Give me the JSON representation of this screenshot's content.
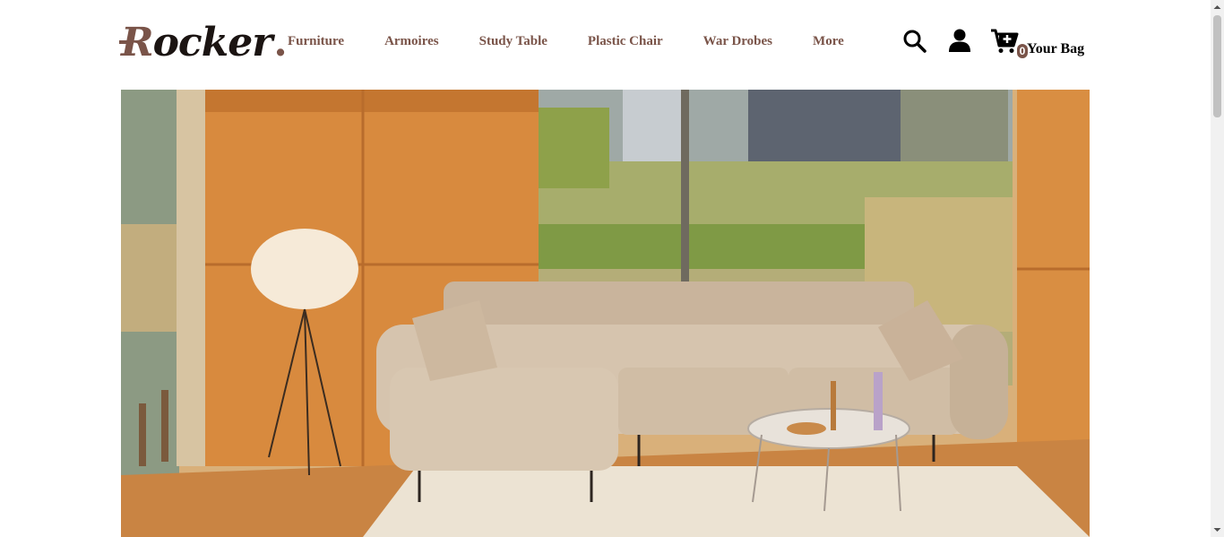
{
  "brand": {
    "logo_initial": "R",
    "logo_rest": "ocker",
    "logo_dot": "."
  },
  "nav": {
    "items": [
      {
        "label": "Furniture"
      },
      {
        "label": "Armoires"
      },
      {
        "label": "Study Table"
      },
      {
        "label": "Plastic Chair"
      },
      {
        "label": "War Drobes"
      },
      {
        "label": "More"
      }
    ]
  },
  "header_icons": {
    "search": "search-icon",
    "user": "user-icon",
    "cart": "cart-plus-icon"
  },
  "cart": {
    "count": "0",
    "label": "Your Bag"
  },
  "hero": {
    "image_subject": "living room with beige sectional sofa, paper floor lamp, wood paneling and garden view"
  },
  "colors": {
    "accent": "#7a5449",
    "text_dark": "#000000",
    "background": "#ffffff"
  }
}
